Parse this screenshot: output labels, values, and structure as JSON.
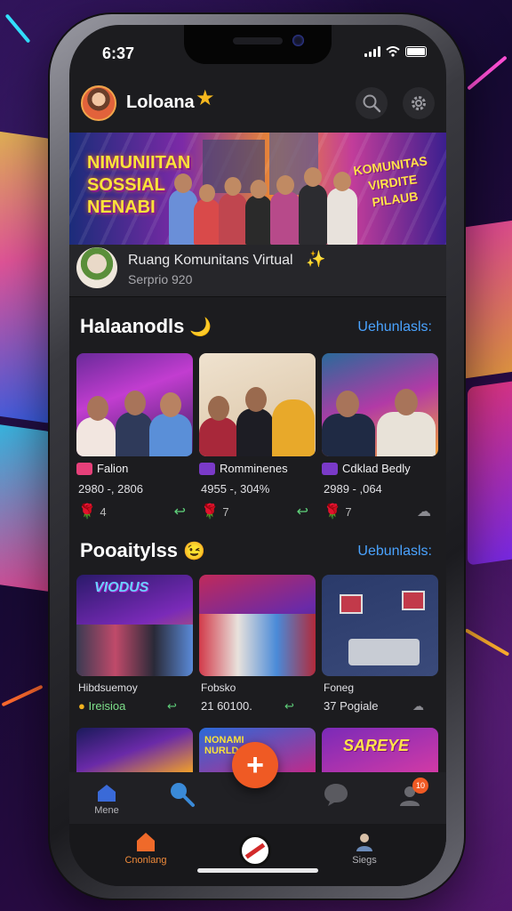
{
  "status": {
    "time": "6:37"
  },
  "header": {
    "username": "Loloana"
  },
  "banner": {
    "left_title_lines": [
      "NIMUNIITAN",
      "SOSSIAL",
      "NENABI"
    ],
    "right_title_lines": [
      "KOMUNITAS",
      "VIRDITE",
      "PILAUB"
    ]
  },
  "post": {
    "title": "Ruang Komunitans Virtual",
    "subtitle": "Serprio 920"
  },
  "section1": {
    "title": "Halaanodls",
    "see_all": "Uehunlasls:",
    "cards": [
      {
        "tag": "Falion",
        "stats": "2980 -, 2806",
        "likes": "4"
      },
      {
        "tag": "Romminenes",
        "stats": "4955 -, 304%",
        "likes": "7"
      },
      {
        "tag": "Cdklad Bedly",
        "stats": "2989 - ,064",
        "likes": "7"
      }
    ]
  },
  "section2": {
    "title": "Pooaitylss",
    "see_all": "Uebunlasls:",
    "cards": [
      {
        "banner": "VIODUS",
        "label": "Hibdsuemoy",
        "meta": "Ireisioa"
      },
      {
        "banner": "",
        "label": "Fobsko",
        "meta": "21 60100."
      },
      {
        "banner": "",
        "label": "Foneg",
        "meta": "37 Pogiale"
      }
    ],
    "row3_banners": [
      "",
      "NONAMI NURLD",
      "SAREYE"
    ]
  },
  "nav": {
    "home_label": "Mene",
    "bottom_left_label": "Cnonlang",
    "bottom_right_label": "Siegs",
    "badge": "10"
  },
  "colors": {
    "accent": "#ef5a24",
    "link": "#4aa3ff",
    "star": "#f5b71e"
  }
}
